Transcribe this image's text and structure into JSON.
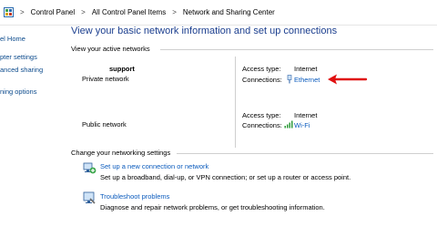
{
  "breadcrumb": {
    "items": [
      "Control Panel",
      "All Control Panel Items",
      "Network and Sharing Center"
    ],
    "separator": ">"
  },
  "left_pane": {
    "links": [
      "el Home",
      "pter settings",
      "anced sharing",
      "ning options"
    ]
  },
  "main": {
    "title": "View your basic network information and set up connections",
    "active_networks_heading": "View your active networks",
    "networks": [
      {
        "name": "support",
        "category": "Private network",
        "access_type_label": "Access type:",
        "access_type_value": "Internet",
        "connections_label": "Connections:",
        "connection_name": "Ethernet",
        "connection_icon": "ethernet-icon"
      },
      {
        "name": "",
        "category": "Public network",
        "access_type_label": "Access type:",
        "access_type_value": "Internet",
        "connections_label": "Connections:",
        "connection_name": "Wi-Fi",
        "connection_icon": "wifi-signal-icon"
      }
    ],
    "change_settings_heading": "Change your networking settings",
    "tasks": [
      {
        "link": "Set up a new connection or network",
        "description": "Set up a broadband, dial-up, or VPN connection; or set up a router or access point.",
        "icon": "new-connection-icon"
      },
      {
        "link": "Troubleshoot problems",
        "description": "Diagnose and repair network problems, or get troubleshooting information.",
        "icon": "troubleshoot-icon"
      }
    ]
  },
  "colors": {
    "title": "#1c3f8f",
    "link": "#0b5bbd",
    "annotation_arrow": "#e01010"
  }
}
